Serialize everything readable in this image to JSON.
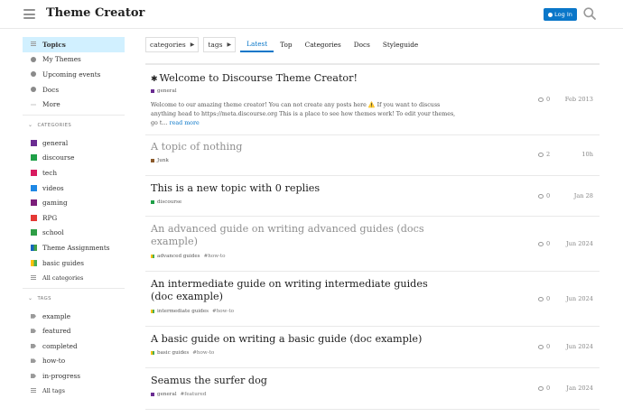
{
  "header": {
    "site_title": "Theme Creator",
    "login_label": "Log In"
  },
  "sidebar": {
    "main_items": [
      {
        "label": "Topics",
        "icon": "topics-icon",
        "active": true
      },
      {
        "label": "My Themes",
        "icon": "palette-icon"
      },
      {
        "label": "Upcoming events",
        "icon": "link-icon"
      },
      {
        "label": "Docs",
        "icon": "link-icon"
      },
      {
        "label": "More",
        "icon": "more-dots-icon"
      }
    ],
    "categories_heading": "CATEGORIES",
    "categories": [
      {
        "label": "general",
        "color": "#6a2c91"
      },
      {
        "label": "discourse",
        "color": "#1fa048"
      },
      {
        "label": "tech",
        "color": "#d81b60"
      },
      {
        "label": "videos",
        "color": "#1e88e5"
      },
      {
        "label": "gaming",
        "color": "#7b1e7a"
      },
      {
        "label": "RPG",
        "color": "#e53935"
      },
      {
        "label": "school",
        "color": "#2e9e46"
      },
      {
        "label": "Theme Assignments",
        "color": "#1565c0",
        "color2": "#43a047"
      },
      {
        "label": "basic guides",
        "color": "#ffc107",
        "color2": "#4caf50"
      }
    ],
    "all_categories": "All categories",
    "tags_heading": "TAGS",
    "tags": [
      "example",
      "featured",
      "completed",
      "how-to",
      "in-progress"
    ],
    "all_tags": "All tags"
  },
  "nav": {
    "categories_dropdown": "categories",
    "tags_dropdown": "tags",
    "tabs": [
      "Latest",
      "Top",
      "Categories",
      "Docs",
      "Styleguide"
    ],
    "active_tab": "Latest"
  },
  "topics": [
    {
      "title": "Welcome to Discourse Theme Creator!",
      "pinned": true,
      "category": "general",
      "category_color": "#6a2c91",
      "tags": [],
      "excerpt": "Welcome to our amazing theme creator! You can not create any posts here ⚠️ If you want to discuss anything head to https://meta.discourse.org This is a place to see how themes work! To edit your themes, go t…",
      "read_more": "read more",
      "replies": "0",
      "activity": "Feb 2013",
      "visited": false
    },
    {
      "title": "A topic of nothing",
      "category": "Junk",
      "category_color": "#8b5a2b",
      "tags": [],
      "replies": "2",
      "activity": "10h",
      "visited": true
    },
    {
      "title": "This is a new topic with 0 replies",
      "category": "discourse",
      "category_color": "#1fa048",
      "tags": [],
      "replies": "0",
      "activity": "Jan 28",
      "visited": false
    },
    {
      "title": "An advanced guide on writing advanced guides (docs example)",
      "category": "advanced guides",
      "category_color": "#ffc107",
      "tags": [
        "#how-to"
      ],
      "replies": "0",
      "activity": "Jun 2024",
      "visited": true
    },
    {
      "title": "An intermediate guide on writing intermediate guides (doc example)",
      "category": "intermediate guides",
      "category_color": "#ffc107",
      "tags": [
        "#how-to"
      ],
      "replies": "0",
      "activity": "Jun 2024",
      "visited": false
    },
    {
      "title": "A basic guide on writing a basic guide (doc example)",
      "category": "basic guides",
      "category_color": "#4caf50",
      "tags": [
        "#how-to"
      ],
      "replies": "0",
      "activity": "Jun 2024",
      "visited": false
    },
    {
      "title": "Seamus the surfer dog",
      "category": "general",
      "category_color": "#6a2c91",
      "tags": [
        "#featured"
      ],
      "replies": "0",
      "activity": "Jan 2024",
      "visited": false
    }
  ]
}
